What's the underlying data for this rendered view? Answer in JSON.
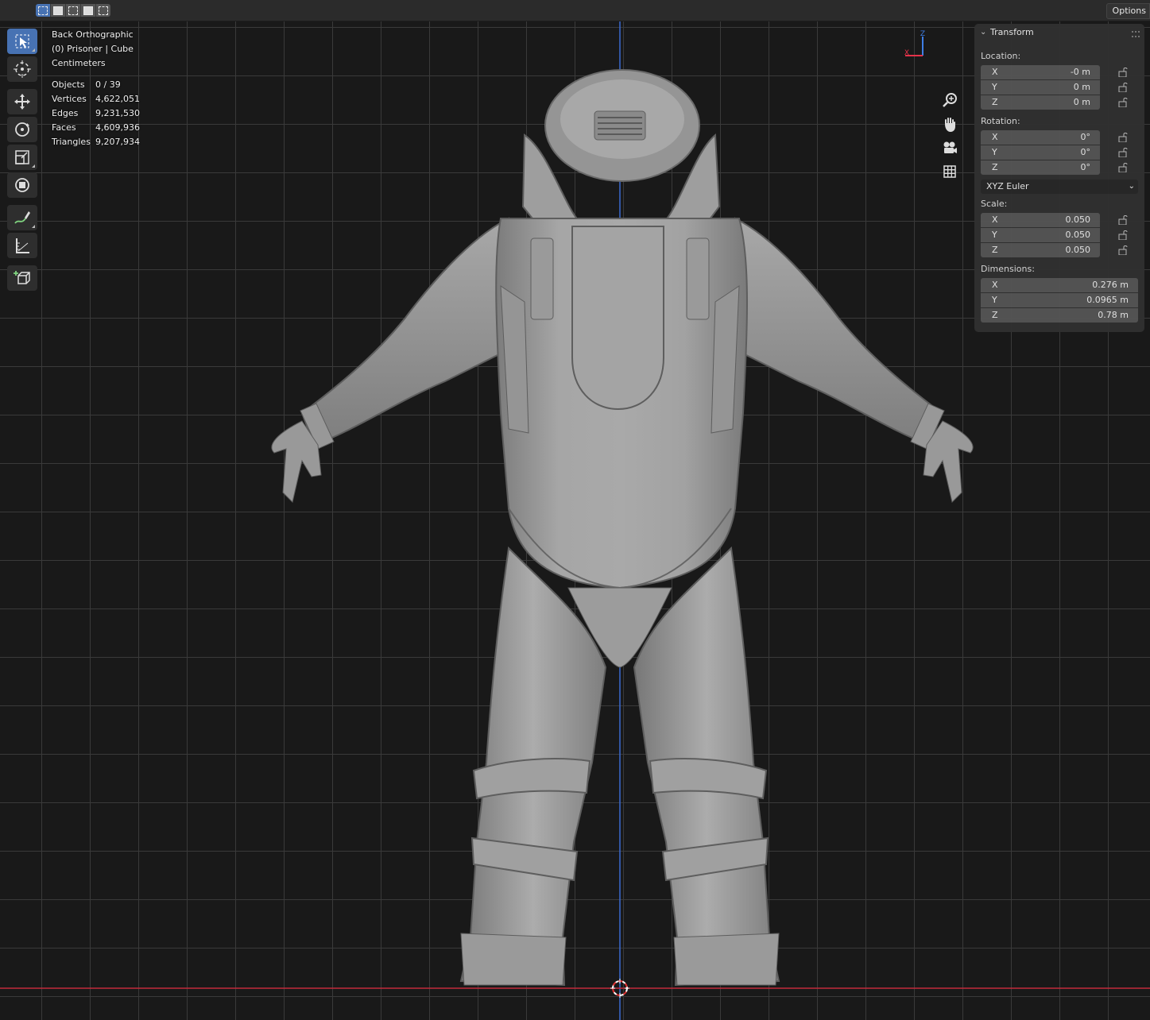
{
  "header": {
    "options_label": "Options",
    "select_modes": [
      "select-new-icon",
      "select-extend-icon",
      "select-subtract-icon",
      "select-invert-icon",
      "select-intersect-icon"
    ]
  },
  "toolbar": {
    "tools": [
      "select-box-icon",
      "cursor-icon",
      "move-icon",
      "rotate-icon",
      "scale-icon",
      "transform-icon",
      "annotate-icon",
      "measure-icon",
      "add-cube-icon"
    ],
    "active_tool": "select-box-icon"
  },
  "overlay": {
    "view_name": "Back Orthographic",
    "object_info": "(0) Prisoner | Cube",
    "units": "Centimeters"
  },
  "stats": [
    {
      "label": "Objects",
      "value": "0 / 39"
    },
    {
      "label": "Vertices",
      "value": "4,622,051"
    },
    {
      "label": "Edges",
      "value": "9,231,530"
    },
    {
      "label": "Faces",
      "value": "4,609,936"
    },
    {
      "label": "Triangles",
      "value": "9,207,934"
    }
  ],
  "gizmo": {
    "x_label": "X",
    "z_label": "Z",
    "x_color": "#e5324a",
    "z_color": "#3e7ee5"
  },
  "nav_icons": [
    "zoom-icon",
    "pan-hand-icon",
    "camera-icon",
    "grid-ortho-icon"
  ],
  "transform_panel": {
    "title": "Transform",
    "location_label": "Location:",
    "location": [
      {
        "axis": "X",
        "value": "-0 m"
      },
      {
        "axis": "Y",
        "value": "0 m"
      },
      {
        "axis": "Z",
        "value": "0 m"
      }
    ],
    "rotation_label": "Rotation:",
    "rotation": [
      {
        "axis": "X",
        "value": "0°"
      },
      {
        "axis": "Y",
        "value": "0°"
      },
      {
        "axis": "Z",
        "value": "0°"
      }
    ],
    "rotation_mode": "XYZ Euler",
    "scale_label": "Scale:",
    "scale": [
      {
        "axis": "X",
        "value": "0.050"
      },
      {
        "axis": "Y",
        "value": "0.050"
      },
      {
        "axis": "Z",
        "value": "0.050"
      }
    ],
    "dimensions_label": "Dimensions:",
    "dimensions": [
      {
        "axis": "X",
        "value": "0.276 m"
      },
      {
        "axis": "Y",
        "value": "0.0965 m"
      },
      {
        "axis": "Z",
        "value": "0.78 m"
      }
    ]
  },
  "colors": {
    "accent": "#4772b3",
    "grid_bg": "#191919",
    "z_axis_line": "#3a6ad1",
    "x_axis_line": "#c22a3a",
    "model": "#9a9a9a"
  }
}
